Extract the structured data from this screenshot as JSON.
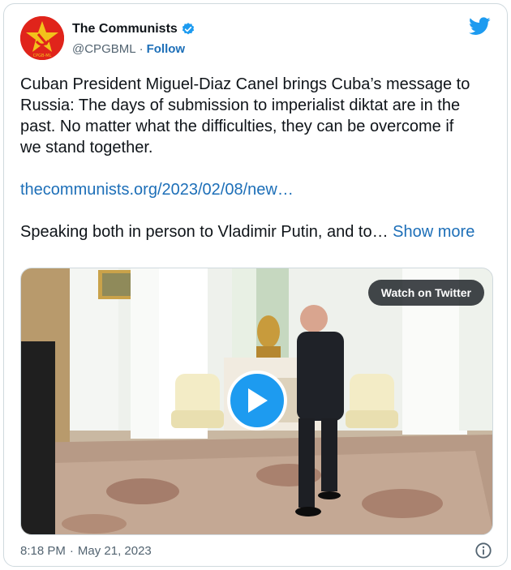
{
  "account": {
    "name": "The Communists",
    "handle": "@CPGBML",
    "separator": "·",
    "follow_label": "Follow",
    "avatar_text": "CPGB-ML"
  },
  "icons": {
    "verified": "verified-badge-icon",
    "twitter": "twitter-bird-icon",
    "play": "play-icon",
    "info": "info-icon"
  },
  "colors": {
    "accent": "#1d9bf0",
    "link": "#1d6fb8",
    "avatar_bg": "#e0241b"
  },
  "tweet": {
    "text_line1": "Cuban President Miguel-Diaz Canel brings Cuba’s message to",
    "text_line2": "Russia: The days of submission to imperialist diktat are in the",
    "text_line3": "past. No matter what the difficulties, they can be overcome if",
    "text_line4": "we stand together.",
    "link": "thecommunists.org/2023/02/08/new…",
    "snippet": "Speaking both in person to Vladimir Putin, and to… ",
    "show_more": "Show more"
  },
  "media": {
    "watch_label": "Watch on Twitter"
  },
  "footer": {
    "time": "8:18 PM",
    "separator": "·",
    "date": "May 21, 2023"
  }
}
